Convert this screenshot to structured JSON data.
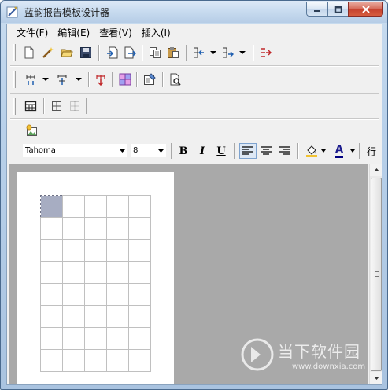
{
  "window": {
    "title": "蓝韵报告模板设计器",
    "controls": {
      "minimize": "minimize",
      "maximize": "maximize",
      "close": "close"
    }
  },
  "menu": [
    {
      "label": "文件(F)"
    },
    {
      "label": "编辑(E)"
    },
    {
      "label": "查看(V)"
    },
    {
      "label": "插入(I)"
    }
  ],
  "toolbar_format": {
    "font_family": "Tahoma",
    "font_size": "8",
    "bold_label": "B",
    "italic_label": "I",
    "underline_label": "U",
    "font_color_label": "A",
    "line_label": "行"
  },
  "sheet": {
    "columns": 5,
    "rows": 8,
    "selected_cell": {
      "row": 1,
      "column": 1
    }
  },
  "watermark": {
    "text": "当下软件园",
    "url": "www.downxia.com"
  },
  "colors": {
    "workspace": "#a9a9a9",
    "selected_cell": "#a7adc2",
    "titlebar": "#c7dbef"
  }
}
